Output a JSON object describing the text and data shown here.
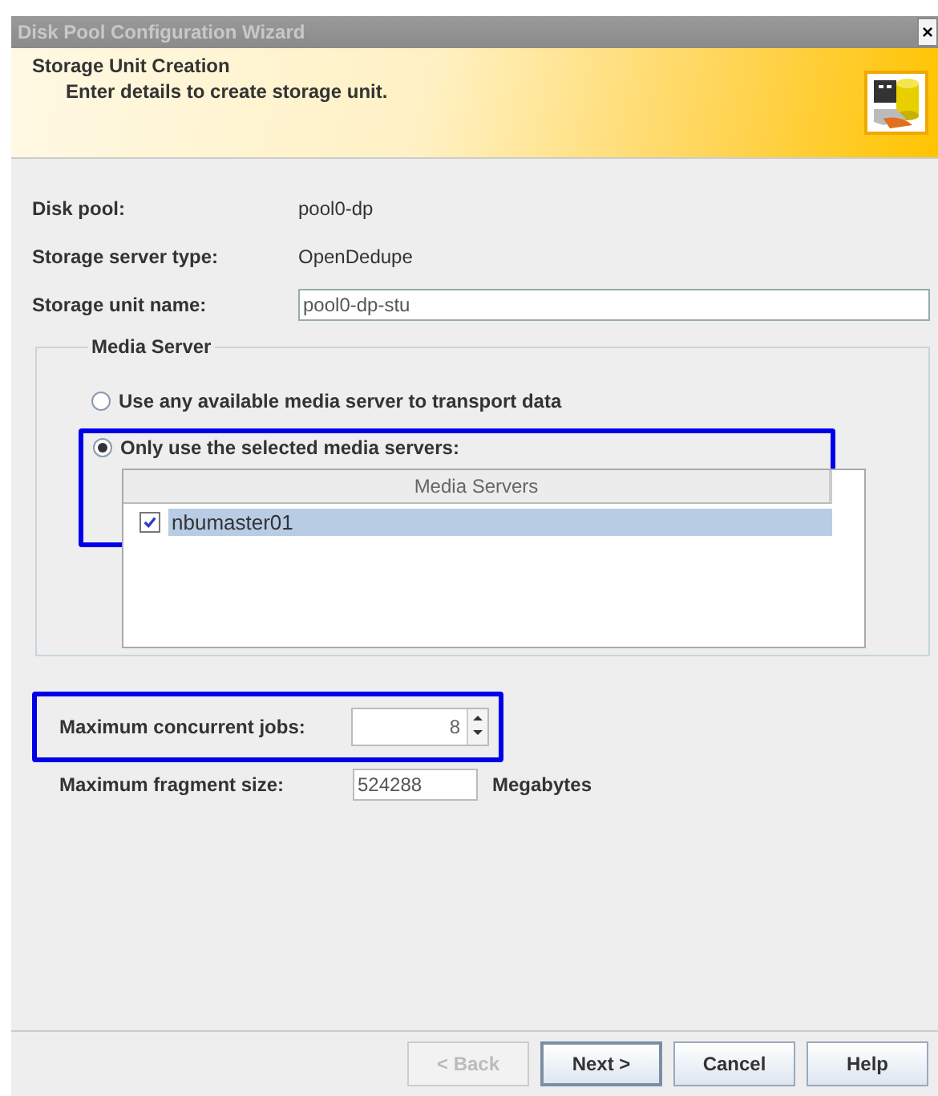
{
  "window": {
    "title": "Disk Pool Configuration Wizard",
    "close": "×"
  },
  "header": {
    "title": "Storage Unit Creation",
    "subtitle": "Enter details to create storage unit."
  },
  "info": [
    {
      "label": "Disk pool:",
      "value": "pool0-dp"
    },
    {
      "label": "Storage server type:",
      "value": "OpenDedupe"
    }
  ],
  "unit_name": {
    "label": "Storage unit name:",
    "value": "pool0-dp-stu"
  },
  "media_server": {
    "title": "Media Server",
    "options": [
      {
        "label": "Use any available media server to transport data",
        "selected": false,
        "highlighted": false
      },
      {
        "label": "Only use the selected media servers:",
        "selected": true,
        "highlighted": true
      }
    ],
    "table": {
      "columns": [
        "Media Servers"
      ],
      "rows": [
        {
          "name": "nbumaster01",
          "checked": true,
          "selected": true
        }
      ]
    }
  },
  "max_jobs": {
    "label": "Maximum concurrent jobs:",
    "value": "8",
    "highlighted": true
  },
  "fragment": {
    "label": "Maximum fragment size:",
    "value": "524288",
    "unit": "Megabytes"
  },
  "buttons": [
    {
      "label": "< Back",
      "disabled": true,
      "default": false
    },
    {
      "label": "Next >",
      "disabled": false,
      "default": true
    },
    {
      "label": "Cancel",
      "disabled": false,
      "default": false
    },
    {
      "label": "Help",
      "disabled": false,
      "default": false
    }
  ]
}
